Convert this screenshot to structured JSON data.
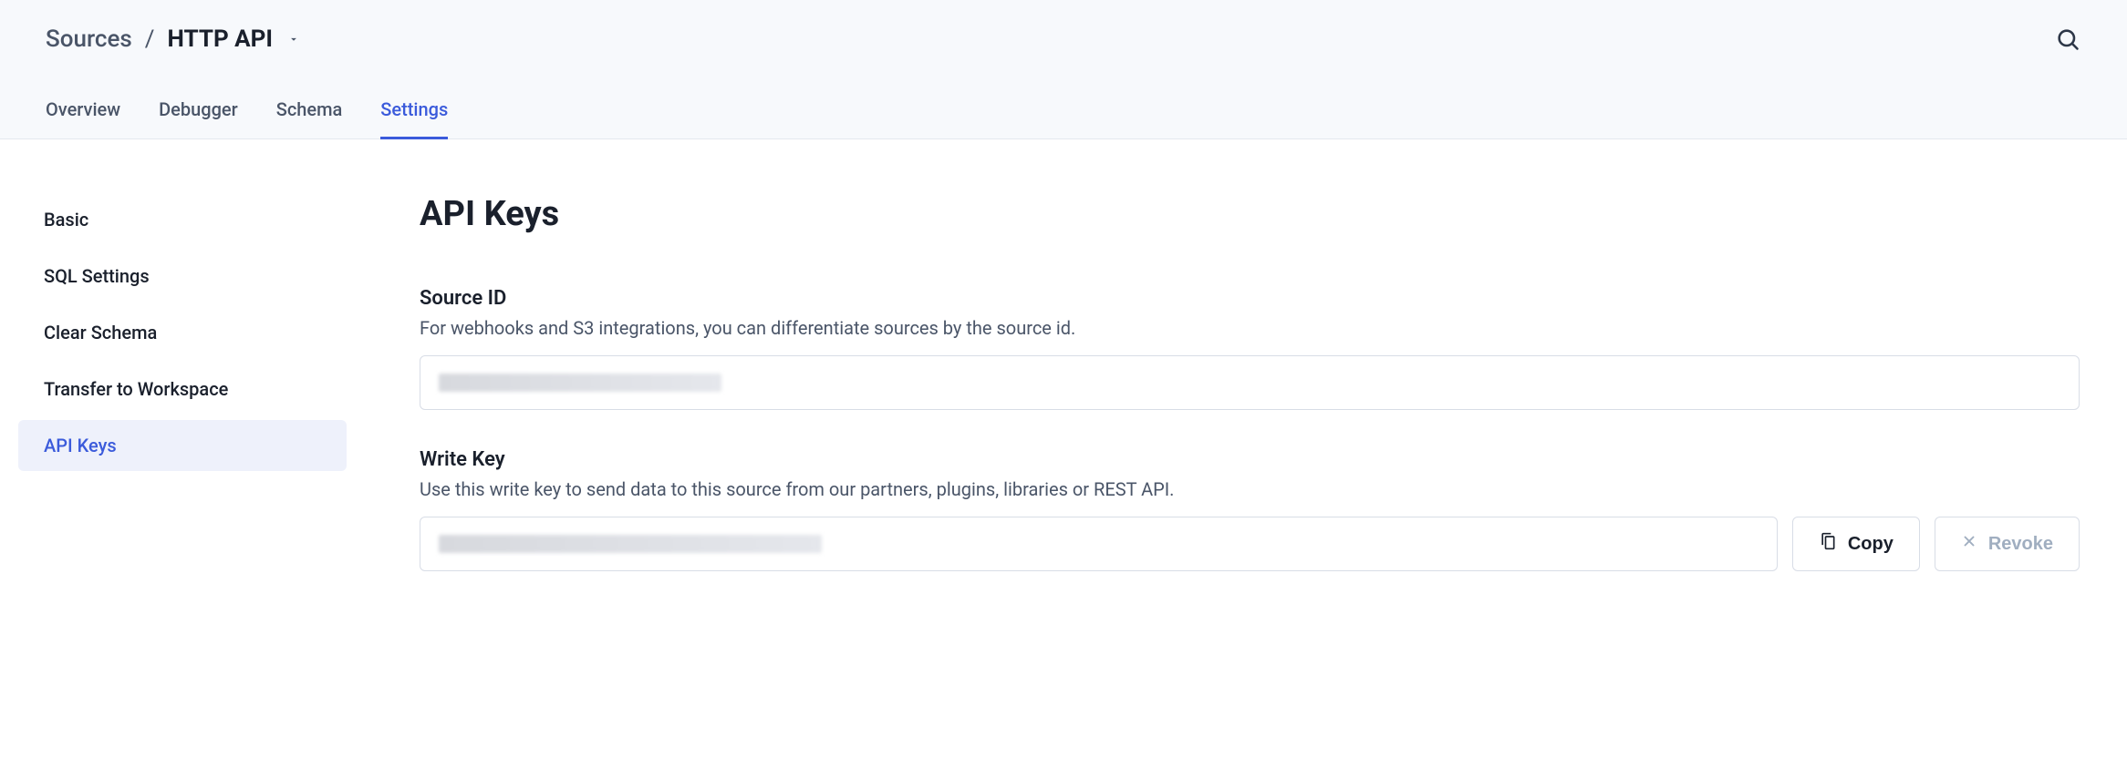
{
  "breadcrumb": {
    "parent": "Sources",
    "separator": "/",
    "current": "HTTP API"
  },
  "tabs": [
    {
      "label": "Overview",
      "active": false
    },
    {
      "label": "Debugger",
      "active": false
    },
    {
      "label": "Schema",
      "active": false
    },
    {
      "label": "Settings",
      "active": true
    }
  ],
  "sidebar": [
    {
      "label": "Basic",
      "active": false
    },
    {
      "label": "SQL Settings",
      "active": false
    },
    {
      "label": "Clear Schema",
      "active": false
    },
    {
      "label": "Transfer to Workspace",
      "active": false
    },
    {
      "label": "API Keys",
      "active": true
    }
  ],
  "page": {
    "title": "API Keys",
    "source_id": {
      "title": "Source ID",
      "description": "For webhooks and S3 integrations, you can differentiate sources by the source id.",
      "value": ""
    },
    "write_key": {
      "title": "Write Key",
      "description": "Use this write key to send data to this source from our partners, plugins, libraries or REST API.",
      "value": "",
      "copy_label": "Copy",
      "revoke_label": "Revoke"
    }
  }
}
